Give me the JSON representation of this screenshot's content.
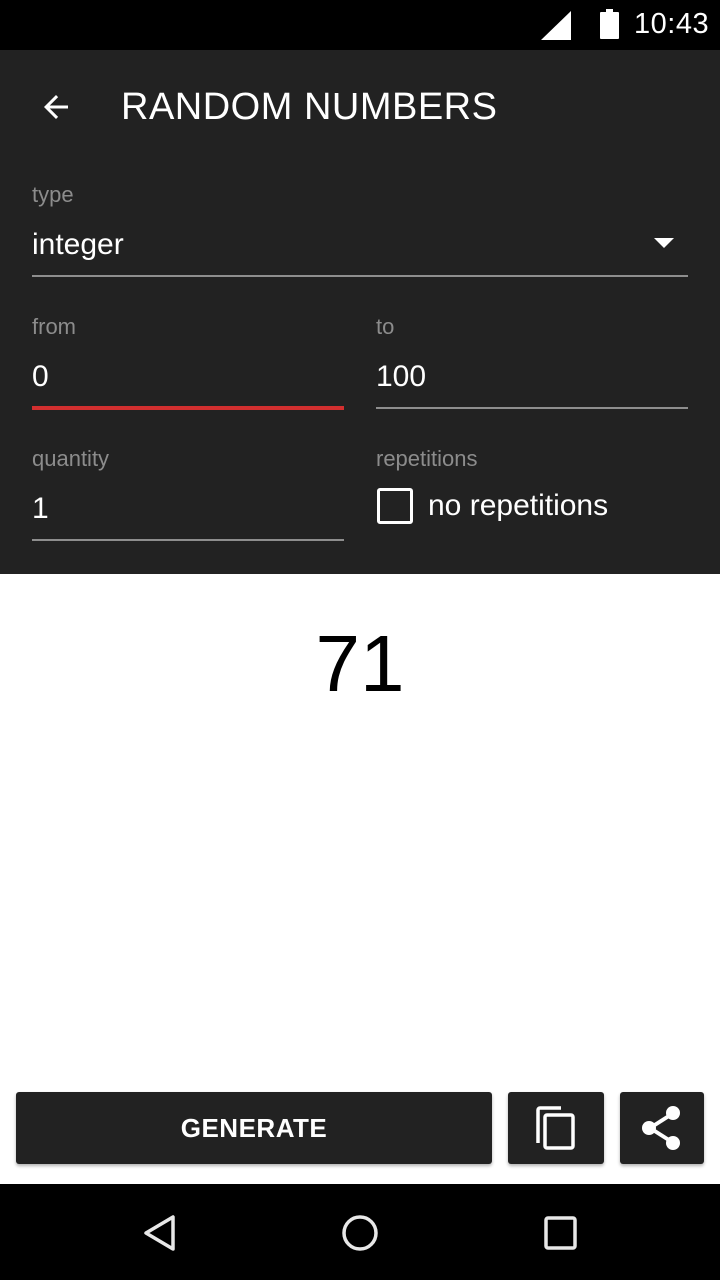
{
  "status_bar": {
    "time": "10:43",
    "icons": [
      "signal-icon",
      "battery-icon"
    ]
  },
  "header": {
    "title": "RANDOM NUMBERS",
    "back_icon": "arrow-back-icon"
  },
  "form": {
    "type": {
      "label": "type",
      "value": "integer",
      "icon": "dropdown-arrow-icon"
    },
    "from": {
      "label": "from",
      "value": "0",
      "focused": true
    },
    "to": {
      "label": "to",
      "value": "100"
    },
    "quantity": {
      "label": "quantity",
      "value": "1"
    },
    "repetitions": {
      "label": "repetitions",
      "checkbox_label": "no repetitions",
      "checked": false
    }
  },
  "result": {
    "value": "71"
  },
  "actions": {
    "generate_label": "GENERATE",
    "copy_icon": "copy-icon",
    "share_icon": "share-icon"
  },
  "colors": {
    "header_bg": "#222222",
    "accent_focus": "#d32f2f",
    "label": "#8c8c8c",
    "button_bg": "#222222"
  },
  "nav_bar": {
    "buttons": [
      "back",
      "home",
      "recents"
    ]
  }
}
